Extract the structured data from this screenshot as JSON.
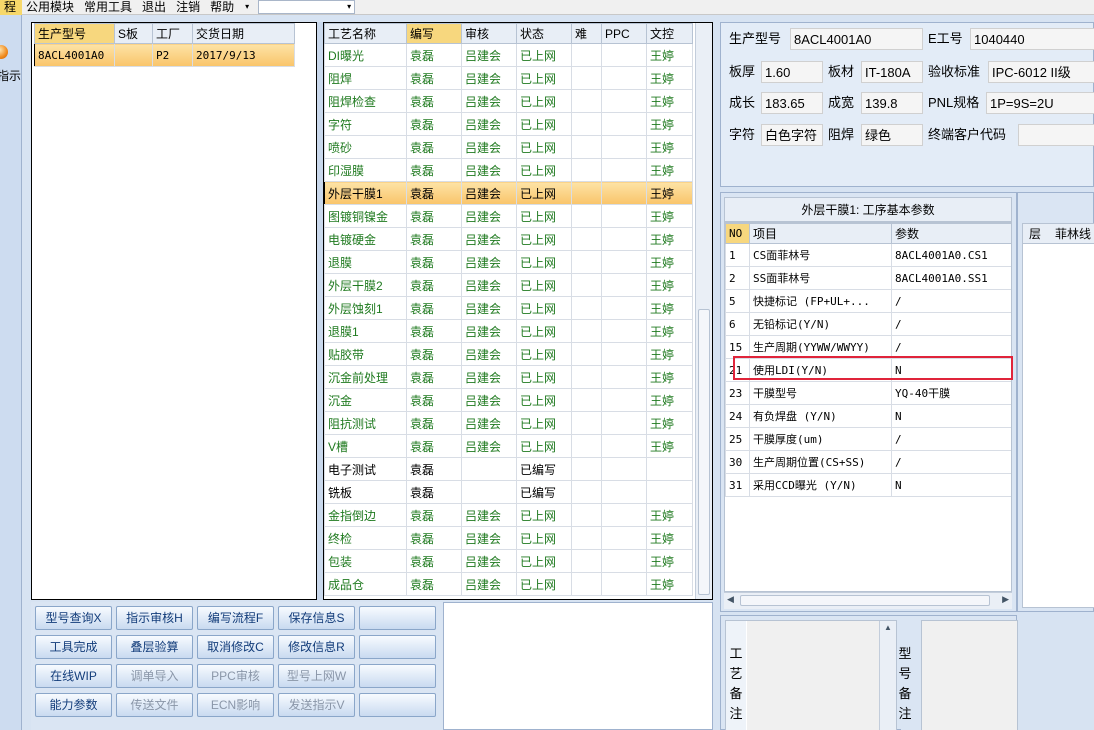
{
  "menu": {
    "items": [
      {
        "label": "程",
        "active": true
      },
      {
        "label": "公用模块"
      },
      {
        "label": "常用工具"
      },
      {
        "label": "退出"
      },
      {
        "label": "注销"
      },
      {
        "label": "帮助"
      }
    ],
    "help_arrow": "▾",
    "combo_arrow": "▾"
  },
  "left_strip": {
    "button_label": "指示"
  },
  "orders": {
    "columns": [
      "生产型号",
      "S板",
      "工厂",
      "交货日期"
    ],
    "rows": [
      {
        "model": "8ACL4001A0",
        "s_board": "",
        "factory": "P2",
        "date": "2017/9/13"
      }
    ]
  },
  "process": {
    "columns": [
      "工艺名称",
      "编写",
      "审核",
      "状态",
      "难",
      "PPC",
      "文控"
    ],
    "rows": [
      [
        "DI曝光",
        "袁磊",
        "吕建会",
        "已上网",
        "",
        "",
        "王婷"
      ],
      [
        "阻焊",
        "袁磊",
        "吕建会",
        "已上网",
        "",
        "",
        "王婷"
      ],
      [
        "阻焊检查",
        "袁磊",
        "吕建会",
        "已上网",
        "",
        "",
        "王婷"
      ],
      [
        "字符",
        "袁磊",
        "吕建会",
        "已上网",
        "",
        "",
        "王婷"
      ],
      [
        "喷砂",
        "袁磊",
        "吕建会",
        "已上网",
        "",
        "",
        "王婷"
      ],
      [
        "印湿膜",
        "袁磊",
        "吕建会",
        "已上网",
        "",
        "",
        "王婷"
      ],
      [
        "外层干膜1",
        "袁磊",
        "吕建会",
        "已上网",
        "",
        "",
        "王婷"
      ],
      [
        "图镀铜镍金",
        "袁磊",
        "吕建会",
        "已上网",
        "",
        "",
        "王婷"
      ],
      [
        "电镀硬金",
        "袁磊",
        "吕建会",
        "已上网",
        "",
        "",
        "王婷"
      ],
      [
        "退膜",
        "袁磊",
        "吕建会",
        "已上网",
        "",
        "",
        "王婷"
      ],
      [
        "外层干膜2",
        "袁磊",
        "吕建会",
        "已上网",
        "",
        "",
        "王婷"
      ],
      [
        "外层蚀刻1",
        "袁磊",
        "吕建会",
        "已上网",
        "",
        "",
        "王婷"
      ],
      [
        "退膜1",
        "袁磊",
        "吕建会",
        "已上网",
        "",
        "",
        "王婷"
      ],
      [
        "贴胶带",
        "袁磊",
        "吕建会",
        "已上网",
        "",
        "",
        "王婷"
      ],
      [
        "沉金前处理",
        "袁磊",
        "吕建会",
        "已上网",
        "",
        "",
        "王婷"
      ],
      [
        "沉金",
        "袁磊",
        "吕建会",
        "已上网",
        "",
        "",
        "王婷"
      ],
      [
        "阻抗测试",
        "袁磊",
        "吕建会",
        "已上网",
        "",
        "",
        "王婷"
      ],
      [
        "V槽",
        "袁磊",
        "吕建会",
        "已上网",
        "",
        "",
        "王婷"
      ],
      [
        "电子测试",
        "袁磊",
        "",
        "已编写",
        "",
        "",
        ""
      ],
      [
        "铣板",
        "袁磊",
        "",
        "已编写",
        "",
        "",
        ""
      ],
      [
        "金指倒边",
        "袁磊",
        "吕建会",
        "已上网",
        "",
        "",
        "王婷"
      ],
      [
        "终检",
        "袁磊",
        "吕建会",
        "已上网",
        "",
        "",
        "王婷"
      ],
      [
        "包装",
        "袁磊",
        "吕建会",
        "已上网",
        "",
        "",
        "王婷"
      ],
      [
        "成品仓",
        "袁磊",
        "吕建会",
        "已上网",
        "",
        "",
        "王婷"
      ]
    ],
    "selected_index": 6,
    "pending_status": "已编写"
  },
  "buttons": [
    {
      "label": "型号查询X",
      "enabled": true
    },
    {
      "label": "指示审核H",
      "enabled": true
    },
    {
      "label": "编写流程F",
      "enabled": true
    },
    {
      "label": "保存信息S",
      "enabled": true
    },
    {
      "label": "",
      "enabled": true
    },
    {
      "label": "工具完成",
      "enabled": true
    },
    {
      "label": "叠层验算",
      "enabled": true
    },
    {
      "label": "取消修改C",
      "enabled": true
    },
    {
      "label": "修改信息R",
      "enabled": true
    },
    {
      "label": "",
      "enabled": true
    },
    {
      "label": "在线WIP",
      "enabled": true
    },
    {
      "label": "调单导入",
      "enabled": false
    },
    {
      "label": "PPC审核",
      "enabled": false
    },
    {
      "label": "型号上网W",
      "enabled": false
    },
    {
      "label": "",
      "enabled": true
    },
    {
      "label": "能力参数",
      "enabled": true
    },
    {
      "label": "传送文件",
      "enabled": false
    },
    {
      "label": "ECN影响",
      "enabled": false
    },
    {
      "label": "发送指示V",
      "enabled": false
    },
    {
      "label": "",
      "enabled": true
    }
  ],
  "info": {
    "model_label": "生产型号",
    "model_value": "8ACL4001A0",
    "eno_label": "E工号",
    "eno_value": "1040440",
    "thickness_label": "板厚",
    "thickness_value": "1.60",
    "material_label": "板材",
    "material_value": "IT-180A",
    "standard_label": "验收标准",
    "standard_value": "IPC-6012 II级",
    "length_label": "成长",
    "length_value": "183.65",
    "width_label": "成宽",
    "width_value": "139.8",
    "pnl_label": "PNL规格",
    "pnl_value": "1P=9S=2U",
    "char_label": "字符",
    "char_value": "白色字符",
    "mask_label": "阻焊",
    "mask_value": "绿色",
    "customer_label": "终端客户代码",
    "customer_value": ""
  },
  "params": {
    "title": "外层干膜1: 工序基本参数",
    "columns": [
      "NO",
      "项目",
      "参数"
    ],
    "rows": [
      [
        "1",
        "CS面菲林号",
        "8ACL4001A0.CS1"
      ],
      [
        "2",
        "SS面菲林号",
        "8ACL4001A0.SS1"
      ],
      [
        "5",
        "快捷标记 (FP+UL+...",
        "/"
      ],
      [
        "6",
        "无铅标记(Y/N)",
        "/"
      ],
      [
        "15",
        "生产周期(YYWW/WWYY)",
        "/"
      ],
      [
        "21",
        "使用LDI(Y/N)",
        "N"
      ],
      [
        "23",
        "干膜型号",
        "YQ-40干膜"
      ],
      [
        "24",
        "有负焊盘 (Y/N)",
        "N"
      ],
      [
        "25",
        "干膜厚度(um)",
        "/"
      ],
      [
        "30",
        "生产周期位置(CS+SS)",
        "/"
      ],
      [
        "31",
        "采用CCD曝光 (Y/N)",
        "N"
      ]
    ],
    "highlighted_row": "21",
    "scroll_left": "◀",
    "scroll_right": "▶"
  },
  "film": {
    "columns": [
      "层",
      "菲林线"
    ]
  },
  "notes": {
    "process_label": [
      "工",
      "艺",
      "备",
      "注"
    ],
    "model_label": [
      "型",
      "号",
      "备",
      "注"
    ],
    "scroll_up": "▲"
  },
  "colors": {
    "accent": "#f9c46a",
    "status_green": "#1f7a1f",
    "highlight_red": "#e0243a"
  }
}
